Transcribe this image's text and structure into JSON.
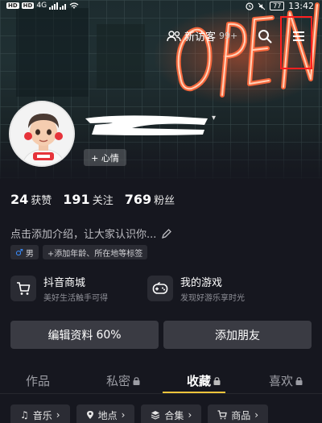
{
  "status_bar": {
    "sim1": "HD",
    "sim2": "HD",
    "signal": "4G",
    "battery": "77",
    "time": "13:42"
  },
  "header": {
    "neon_sign": "OPEN",
    "visitors_label": "新访客",
    "visitors_count": "99+"
  },
  "profile": {
    "mood_label": "+ 心情"
  },
  "stats": [
    {
      "num": "24",
      "label": "获赞"
    },
    {
      "num": "191",
      "label": "关注"
    },
    {
      "num": "769",
      "label": "粉丝"
    }
  ],
  "bio": "点击添加介绍，让大家认识你...",
  "tags": {
    "gender": "男",
    "add_tag": "+添加年龄、所在地等标签"
  },
  "features": [
    {
      "title": "抖音商城",
      "sub": "美好生活触手可得",
      "icon": "cart-icon"
    },
    {
      "title": "我的游戏",
      "sub": "发现好游乐享时光",
      "icon": "gamepad-icon"
    }
  ],
  "buttons": {
    "edit_label": "编辑资料",
    "edit_progress": "60%",
    "add_friend": "添加朋友"
  },
  "tabs": [
    {
      "label": "作品",
      "locked": false,
      "active": false
    },
    {
      "label": "私密",
      "locked": true,
      "active": false
    },
    {
      "label": "收藏",
      "locked": true,
      "active": true
    },
    {
      "label": "喜欢",
      "locked": true,
      "active": false
    }
  ],
  "chips": [
    {
      "label": "音乐",
      "icon": "music-icon"
    },
    {
      "label": "地点",
      "icon": "location-icon"
    },
    {
      "label": "合集",
      "icon": "stack-icon"
    },
    {
      "label": "商品",
      "icon": "cart-icon"
    }
  ],
  "colors": {
    "background": "#16171f",
    "highlight": "#ff1f1f",
    "tab_underline": "#f2c43b",
    "male_blue": "#3a8dff"
  }
}
